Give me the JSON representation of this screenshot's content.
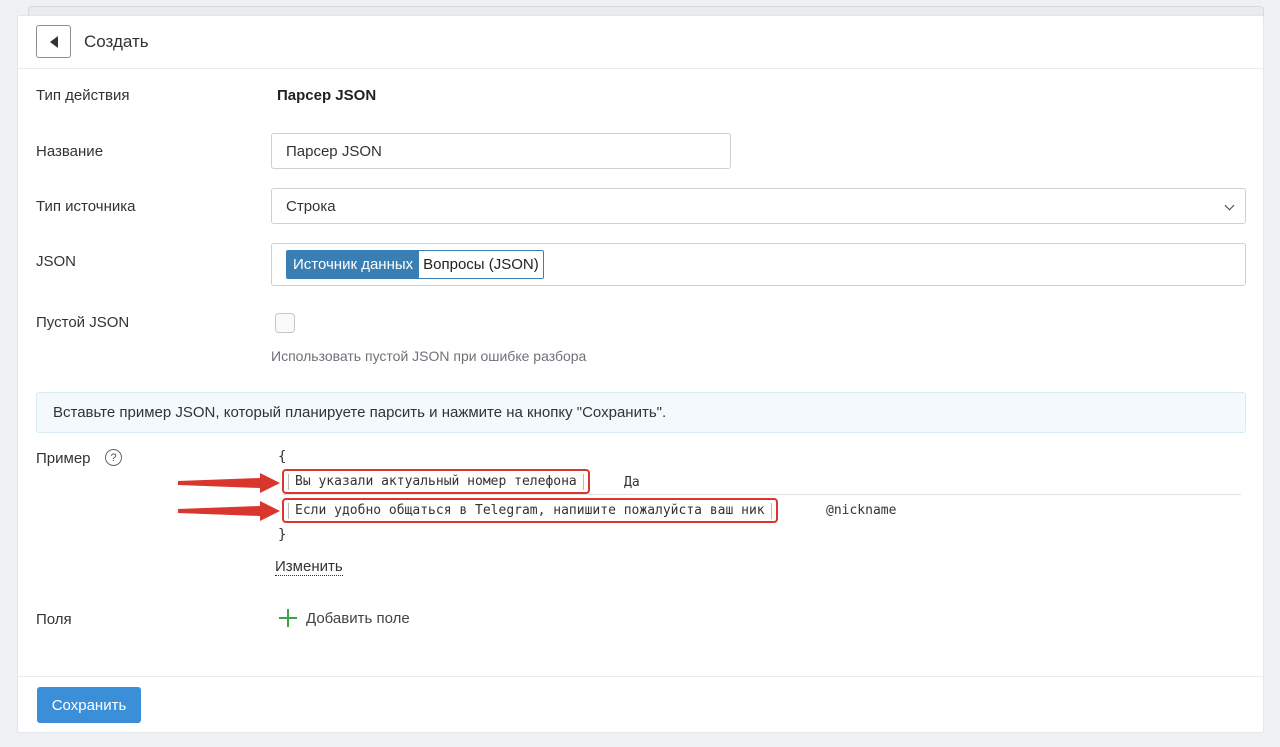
{
  "header": {
    "title": "Создать"
  },
  "form": {
    "action_type": {
      "label": "Тип действия",
      "value": "Парсер JSON"
    },
    "name": {
      "label": "Название",
      "value": "Парсер JSON"
    },
    "source_type": {
      "label": "Тип источника",
      "value": "Строка"
    },
    "json": {
      "label": "JSON",
      "tag_source": "Источник данных",
      "tag_value": "Вопросы (JSON)"
    },
    "empty_json": {
      "label": "Пустой JSON",
      "checked": false,
      "hint": "Использовать пустой JSON при ошибке разбора"
    },
    "info_text": "Вставьте пример JSON, который планируете парсить и нажмите на кнопку \"Сохранить\".",
    "example": {
      "label": "Пример",
      "open_brace": "{",
      "close_brace": "}",
      "rows": [
        {
          "key": "Вы указали актуальный номер телефона",
          "value": "Да"
        },
        {
          "key": "Если удобно общаться в Telegram, напишите пожалуйста ваш ник",
          "value": "@nickname"
        }
      ],
      "edit_label": "Изменить"
    },
    "fields": {
      "label": "Поля",
      "add_label": "Добавить поле"
    }
  },
  "footer": {
    "save_label": "Сохранить"
  },
  "colors": {
    "primary": "#3a8fd8",
    "tag": "#3a7fb4",
    "highlight": "#d9362e",
    "add": "#3aa545"
  }
}
